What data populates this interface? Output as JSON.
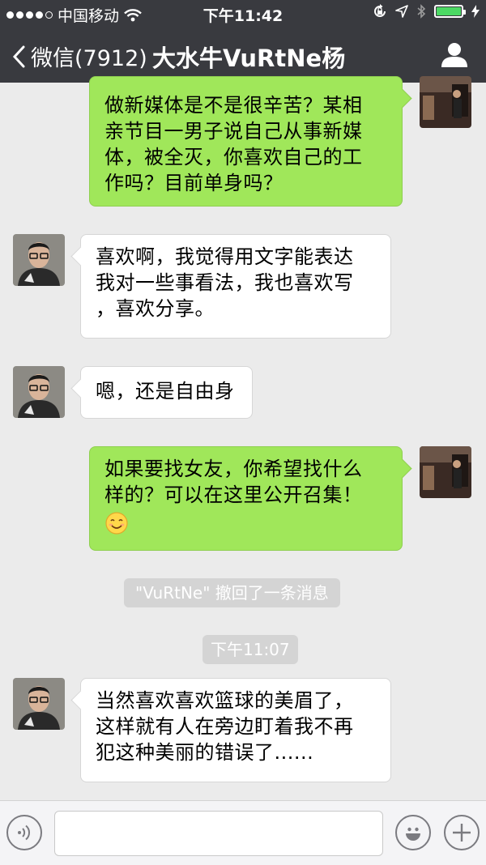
{
  "status_bar": {
    "carrier": "中国移动",
    "time": "下午11:42",
    "battery_level": 1.0
  },
  "nav": {
    "back_label": "微信(7912)",
    "title": "大水牛VuRtNe杨",
    "profile_icon": "person-icon"
  },
  "messages": [
    {
      "side": "out",
      "text_lines": [
        "做新媒体是不是很辛苦？某相",
        "亲节目一男子说自己从事新媒",
        "体，被全灭，你喜欢自己的工",
        "作吗？目前单身吗？"
      ]
    },
    {
      "side": "in",
      "text_lines": [
        "喜欢啊，我觉得用文字能表达",
        "我对一些事看法，我也喜欢写",
        "，喜欢分享。"
      ]
    },
    {
      "side": "in",
      "text_lines": [
        "嗯，还是自由身"
      ]
    },
    {
      "side": "out",
      "text_lines": [
        "如果要找女友，你希望找什么",
        "样的？可以在这里公开召集！"
      ],
      "emoji": "smile-emoji"
    },
    {
      "side": "in",
      "text_lines": [
        "当然喜欢喜欢篮球的美眉了，",
        "这样就有人在旁边盯着我不再",
        "犯这种美丽的错误了......"
      ]
    }
  ],
  "system": {
    "recall_notice": "\"VuRtNe\" 撤回了一条消息",
    "timestamp": "下午11:07"
  },
  "input_bar": {
    "voice_icon": "voice-icon",
    "emoji_icon": "emoji-icon",
    "add_icon": "plus-icon"
  },
  "colors": {
    "nav_bg": "#393a3f",
    "chat_bg": "#ebebeb",
    "outgoing_bubble": "#a0e75a",
    "incoming_bubble": "#ffffff",
    "system_label": "#d4d4d4"
  }
}
